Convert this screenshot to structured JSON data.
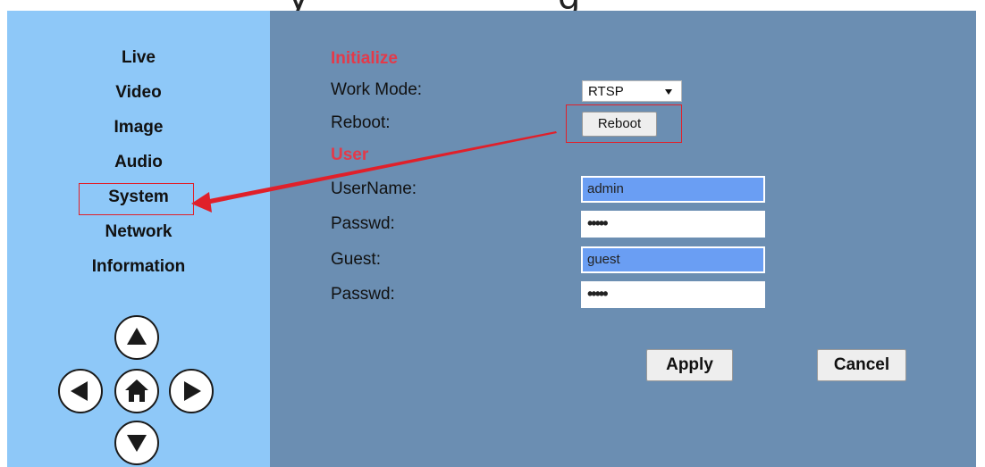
{
  "top_fragments": [
    "y",
    "g"
  ],
  "sidebar": {
    "items": [
      {
        "label": "Live"
      },
      {
        "label": "Video"
      },
      {
        "label": "Image"
      },
      {
        "label": "Audio"
      },
      {
        "label": "System"
      },
      {
        "label": "Network"
      },
      {
        "label": "Information"
      }
    ],
    "ptz": [
      "up-arrow-icon",
      "left-arrow-icon",
      "home-icon",
      "right-arrow-icon",
      "down-arrow-icon"
    ]
  },
  "form": {
    "initialize_title": "Initialize",
    "work_mode_label": "Work Mode:",
    "work_mode_value": "RTSP",
    "reboot_label": "Reboot:",
    "reboot_button": "Reboot",
    "user_title": "User",
    "username_label": "UserName:",
    "username_value": "admin",
    "passwd_label": "Passwd:",
    "passwd_value": "•••••",
    "guest_label": "Guest:",
    "guest_value": "guest",
    "guest_passwd_label": "Passwd:",
    "guest_passwd_value": "•••••",
    "apply_button": "Apply",
    "cancel_button": "Cancel"
  },
  "colors": {
    "sidebar_bg": "#8ec8f8",
    "main_bg": "#6b8eb2",
    "section_title": "#e33a4a",
    "annotation": "#e0202a",
    "autofill": "#6a9ef3"
  }
}
